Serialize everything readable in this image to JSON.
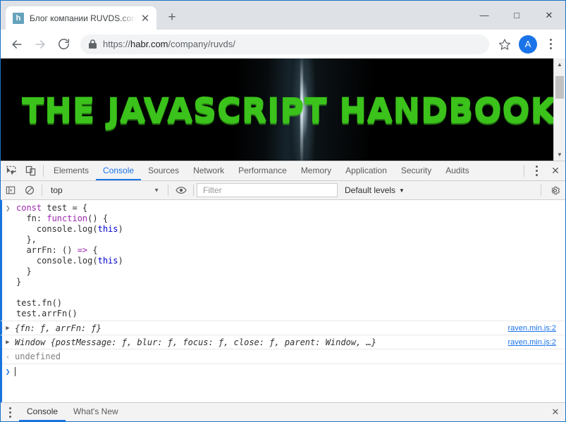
{
  "browser": {
    "tab": {
      "title": "Блог компании RUVDS.com / Ха",
      "favicon_letter": "h",
      "favicon_name": "habr-favicon",
      "close_glyph": "✕"
    },
    "newtab_glyph": "+",
    "window_controls": {
      "minimize": "—",
      "maximize": "□",
      "close": "✕"
    },
    "nav": {
      "back": "←",
      "forward": "→",
      "reload": "⟳"
    },
    "omnibox": {
      "scheme": "https://",
      "host": "habr.com",
      "path": "/company/ruvds/",
      "lock_icon": "lock-icon"
    },
    "star_glyph": "☆",
    "avatar_letter": "A"
  },
  "page": {
    "banner_text": "THE JAVASCRIPT HANDBOOK",
    "banner_bg_color": "#000000",
    "banner_text_color": "#3bc21b"
  },
  "devtools": {
    "tabs": [
      {
        "label": "Elements",
        "active": false
      },
      {
        "label": "Console",
        "active": true
      },
      {
        "label": "Sources",
        "active": false
      },
      {
        "label": "Network",
        "active": false
      },
      {
        "label": "Performance",
        "active": false
      },
      {
        "label": "Memory",
        "active": false
      },
      {
        "label": "Application",
        "active": false
      },
      {
        "label": "Security",
        "active": false
      },
      {
        "label": "Audits",
        "active": false
      }
    ],
    "close_glyph": "✕",
    "accent_color": "#1a73e8",
    "filterbar": {
      "context": "top",
      "filter_placeholder": "Filter",
      "levels": "Default levels",
      "caret": "▼"
    },
    "console": {
      "input_lines": [
        [
          {
            "t": "const ",
            "c": "kw"
          },
          {
            "t": "test ",
            "c": "plain"
          },
          {
            "t": "= {",
            "c": "plain"
          }
        ],
        [
          {
            "t": "  fn: ",
            "c": "plain"
          },
          {
            "t": "function",
            "c": "kw"
          },
          {
            "t": "() {",
            "c": "plain"
          }
        ],
        [
          {
            "t": "    console.log(",
            "c": "plain"
          },
          {
            "t": "this",
            "c": "this"
          },
          {
            "t": ")",
            "c": "plain"
          }
        ],
        [
          {
            "t": "  },",
            "c": "plain"
          }
        ],
        [
          {
            "t": "  arrFn: () ",
            "c": "plain"
          },
          {
            "t": "=>",
            "c": "kw"
          },
          {
            "t": " {",
            "c": "plain"
          }
        ],
        [
          {
            "t": "    console.log(",
            "c": "plain"
          },
          {
            "t": "this",
            "c": "this"
          },
          {
            "t": ")",
            "c": "plain"
          }
        ],
        [
          {
            "t": "  }",
            "c": "plain"
          }
        ],
        [
          {
            "t": "}",
            "c": "plain"
          }
        ],
        [],
        [
          {
            "t": "test.fn()",
            "c": "plain"
          }
        ],
        [
          {
            "t": "test.arrFn()",
            "c": "plain"
          }
        ]
      ],
      "prompt_glyph": "❯",
      "output_rows": [
        {
          "disclosure": "▶",
          "text": "{fn: ƒ, arrFn: ƒ}",
          "source": "raven.min.js:2"
        },
        {
          "disclosure": "▶",
          "text": "Window {postMessage: ƒ, blur: ƒ, focus: ƒ, close: ƒ, parent: Window, …}",
          "source": "raven.min.js:2"
        }
      ],
      "result": {
        "glyph": "‹",
        "value": "undefined"
      },
      "new_prompt_glyph": "❯"
    },
    "drawer": {
      "tabs": [
        {
          "label": "Console",
          "active": true
        },
        {
          "label": "What's New",
          "active": false
        }
      ],
      "close_glyph": "✕"
    }
  }
}
